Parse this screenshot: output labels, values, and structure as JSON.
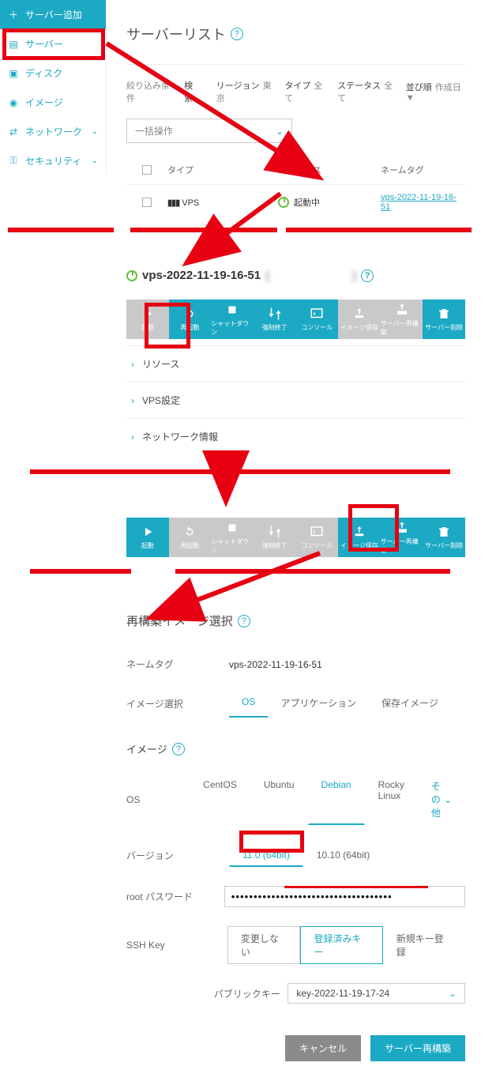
{
  "sidebar": {
    "add": "サーバー追加",
    "items": [
      {
        "icon": "server-icon",
        "label": "サーバー",
        "caret": false
      },
      {
        "icon": "disk-icon",
        "label": "ディスク",
        "caret": false
      },
      {
        "icon": "image-icon",
        "label": "イメージ",
        "caret": false
      },
      {
        "icon": "network-icon",
        "label": "ネットワーク",
        "caret": true
      },
      {
        "icon": "security-icon",
        "label": "セキュリティ",
        "caret": true
      }
    ]
  },
  "page": {
    "title": "サーバーリスト"
  },
  "filter": {
    "heading": "絞り込み条件",
    "search_lbl": "検索",
    "search_val": "-",
    "region_lbl": "リージョン",
    "region_val": "東京",
    "type_lbl": "タイプ",
    "type_val": "全て",
    "status_lbl": "ステータス",
    "status_val": "全て",
    "sort_lbl": "並び順",
    "sort_val": "作成日 ▼"
  },
  "bulk": {
    "label": "一括操作"
  },
  "table": {
    "head": {
      "type": "タイプ",
      "status": "ステータス",
      "name": "ネームタグ"
    },
    "row": {
      "type_icon": "vps-icon",
      "type": "VPS",
      "status": "起動中",
      "name": "vps-2022-11-19-16-51"
    }
  },
  "detail": {
    "name": "vps-2022-11-19-16-51",
    "ip_masked": "(　　　　　　　)",
    "actions1": [
      {
        "k": "start",
        "label": "起動"
      },
      {
        "k": "restart",
        "label": "再起動"
      },
      {
        "k": "shutdown",
        "label": "シャットダウン"
      },
      {
        "k": "force",
        "label": "強制終了"
      },
      {
        "k": "console",
        "label": "コンソール"
      },
      {
        "k": "imgsave",
        "label": "イメージ保存"
      },
      {
        "k": "rebuild",
        "label": "サーバー再構築"
      },
      {
        "k": "delete",
        "label": "サーバー削除"
      }
    ],
    "acc": [
      "リソース",
      "VPS設定",
      "ネットワーク情報"
    ],
    "actions2": [
      {
        "k": "start",
        "label": "起動"
      },
      {
        "k": "restart",
        "label": "再起動"
      },
      {
        "k": "shutdown",
        "label": "シャットダウン"
      },
      {
        "k": "force",
        "label": "強制終了"
      },
      {
        "k": "console",
        "label": "コンソール"
      },
      {
        "k": "imgsave",
        "label": "イメージ保存"
      },
      {
        "k": "rebuild",
        "label": "サーバー再構築"
      },
      {
        "k": "delete",
        "label": "サーバー削除"
      }
    ]
  },
  "rebuild": {
    "title": "再構築イメージ選択",
    "nametag_lbl": "ネームタグ",
    "nametag_val": "vps-2022-11-19-16-51",
    "imgsel_lbl": "イメージ選択",
    "imgsel_tabs": [
      "OS",
      "アプリケーション",
      "保存イメージ"
    ],
    "image_heading": "イメージ",
    "os_lbl": "OS",
    "os_opts": [
      "CentOS",
      "Ubuntu",
      "Debian",
      "Rocky Linux",
      "その他"
    ],
    "ver_lbl": "バージョン",
    "ver_opts": [
      "11.0 (64bit)",
      "10.10 (64bit)"
    ],
    "pwd_lbl": "root パスワード",
    "pwd_val": "••••••••••••••••••••••••••••••••••••",
    "ssh_lbl": "SSH Key",
    "ssh_opts": [
      "変更しない",
      "登録済みキー",
      "新規キー登録"
    ],
    "pubkey_lbl": "パブリックキー",
    "pubkey_val": "key-2022-11-19-17-24",
    "cancel": "キャンセル",
    "submit": "サーバー再構築"
  }
}
